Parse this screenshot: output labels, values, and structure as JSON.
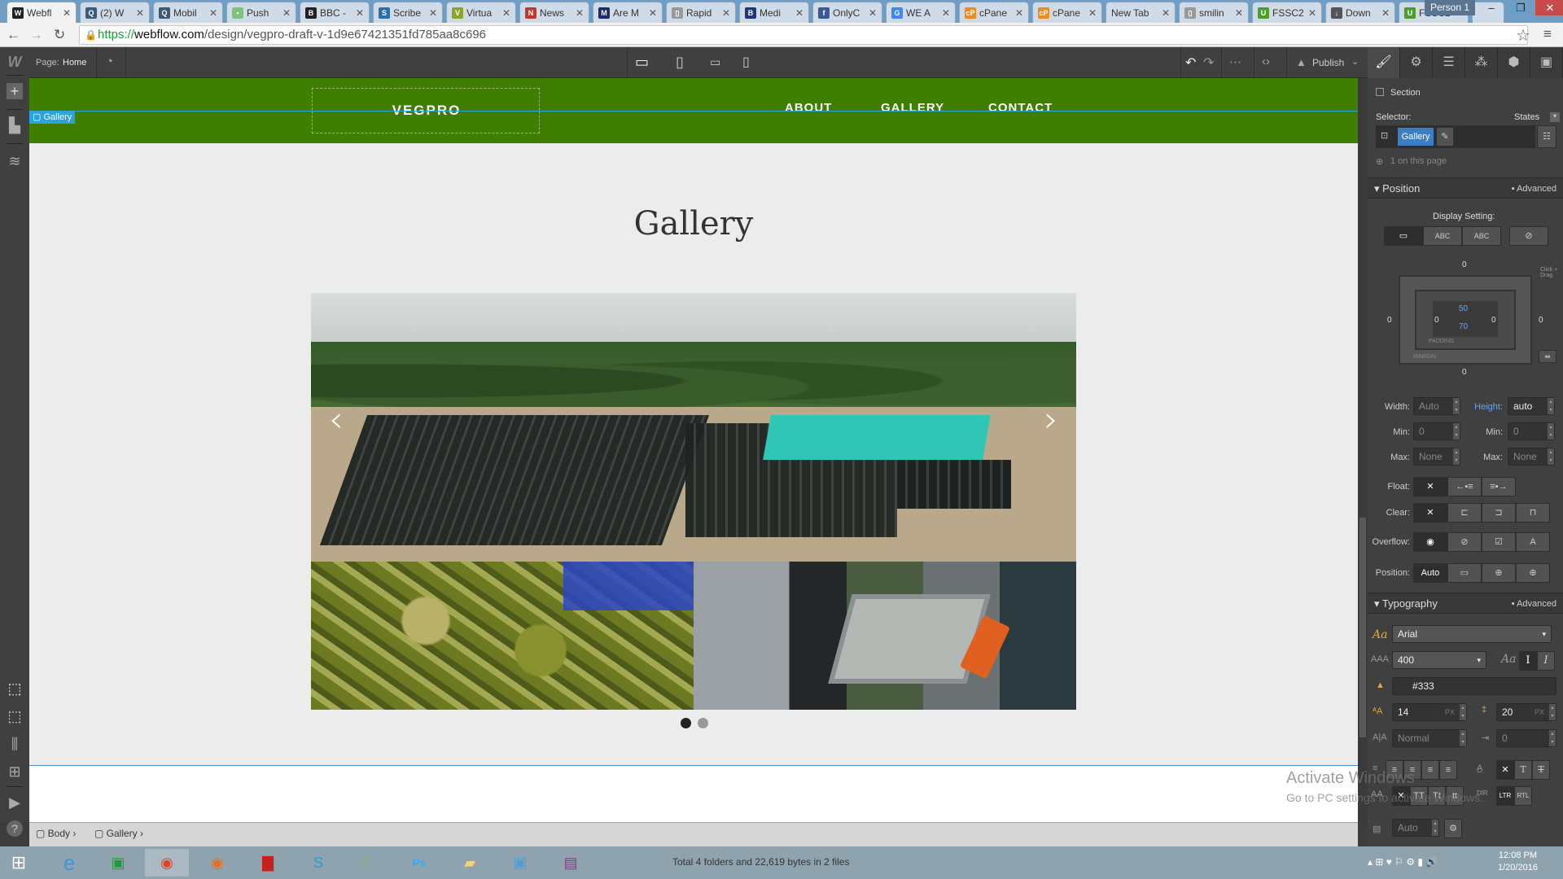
{
  "browser": {
    "tabs": [
      {
        "title": "Webfl",
        "icon": "webflow-icon",
        "color": "#222",
        "glyph": "W",
        "active": true
      },
      {
        "title": "(2) W",
        "icon": "quora-icon",
        "color": "#3a5a7a",
        "glyph": "Q"
      },
      {
        "title": "Mobil",
        "icon": "quora-icon",
        "color": "#3a5a7a",
        "glyph": "Q"
      },
      {
        "title": "Push",
        "icon": "pushbullet-icon",
        "color": "#7ec27e",
        "glyph": "▪"
      },
      {
        "title": "BBC -",
        "icon": "bbc-icon",
        "color": "#222",
        "glyph": "B"
      },
      {
        "title": "Scribe",
        "icon": "scribe-icon",
        "color": "#2a6fb0",
        "glyph": "S"
      },
      {
        "title": "Virtua",
        "icon": "virtual-icon",
        "color": "#8aa52a",
        "glyph": "V"
      },
      {
        "title": "News",
        "icon": "news-icon",
        "color": "#c0392b",
        "glyph": "N"
      },
      {
        "title": "Are M",
        "icon": "mpt-icon",
        "color": "#1c2a6b",
        "glyph": "M"
      },
      {
        "title": "Rapid",
        "icon": "page-icon",
        "color": "#999",
        "glyph": "▯"
      },
      {
        "title": "Medi",
        "icon": "medium-b-icon",
        "color": "#1c3a7a",
        "glyph": "B"
      },
      {
        "title": "OnlyC",
        "icon": "facebook-icon",
        "color": "#3b5998",
        "glyph": "f"
      },
      {
        "title": "WE A",
        "icon": "google-icon",
        "color": "#4285f4",
        "glyph": "G"
      },
      {
        "title": "cPane",
        "icon": "cpanel-icon",
        "color": "#f18a1c",
        "glyph": "cP"
      },
      {
        "title": "cPane",
        "icon": "cpanel-icon",
        "color": "#f18a1c",
        "glyph": "cP"
      },
      {
        "title": "New Tab",
        "icon": "",
        "color": "",
        "glyph": ""
      },
      {
        "title": "smilin",
        "icon": "page-icon",
        "color": "#999",
        "glyph": "▯"
      },
      {
        "title": "FSSC2",
        "icon": "fssc-icon",
        "color": "#4b9e2b",
        "glyph": "U"
      },
      {
        "title": "Down",
        "icon": "download-icon",
        "color": "#555",
        "glyph": "↓"
      },
      {
        "title": "FSSC2",
        "icon": "fssc-icon",
        "color": "#4b9e2b",
        "glyph": "U"
      }
    ],
    "profile": "Person 1",
    "url_protocol": "https://",
    "url_host": "webflow.com",
    "url_path": "/design/vegpro-draft-v-1d9e67421351fd785aa8c696"
  },
  "toolbar": {
    "page_label": "Page:",
    "page_name": "Home",
    "publish_label": "Publish"
  },
  "site": {
    "logo": "VEGPRO",
    "nav": [
      "ABOUT",
      "GALLERY",
      "CONTACT"
    ],
    "selected_element": "Gallery",
    "heading": "Gallery",
    "slider_dots": 2,
    "active_dot": 0
  },
  "panel": {
    "element_type": "Section",
    "selector_label": "Selector:",
    "states_label": "States",
    "selector_class": "Gallery",
    "on_page": "1 on this page",
    "position_title": "Position",
    "advanced_label": "Advanced",
    "display_setting_label": "Display Setting:",
    "display_options": [
      "block",
      "ABC",
      "ABC",
      "none"
    ],
    "box": {
      "margin_top": "0",
      "margin_bottom": "0",
      "margin_left": "0",
      "margin_right": "0",
      "padding_top": "50",
      "padding_bottom": "70",
      "padding_left": "0",
      "padding_right": "0",
      "padding_label": "PADDING",
      "margin_label": "MARGIN",
      "hint": "Click + Drag"
    },
    "width_label": "Width:",
    "width_value": "Auto",
    "height_label": "Height:",
    "height_value": "auto",
    "min_label": "Min:",
    "min_w": "0",
    "min_h": "0",
    "unit": "PX",
    "max_label": "Max:",
    "max_w": "None",
    "max_h": "None",
    "float_label": "Float:",
    "clear_label": "Clear:",
    "overflow_label": "Overflow:",
    "position_label": "Position:",
    "position_value": "Auto",
    "typography_title": "Typography",
    "font": "Arial",
    "weight": "400",
    "color": "#333",
    "font_size": "14",
    "line_height": "20",
    "letter_spacing": "Normal",
    "text_indent": "0",
    "columns": "Auto"
  },
  "breadcrumb": [
    "Body",
    "Gallery"
  ],
  "taskbar": {
    "status": "Total 4 folders and 22,619 bytes in 2 files",
    "time": "12:08 PM",
    "date": "1/20/2016"
  },
  "watermark": {
    "title": "Activate Windows",
    "subtitle": "Go to PC settings to activate Windows."
  },
  "colors": {
    "nav_green": "#3f7e00",
    "selection_blue": "#2aa3de",
    "panel_bg": "#404040"
  }
}
